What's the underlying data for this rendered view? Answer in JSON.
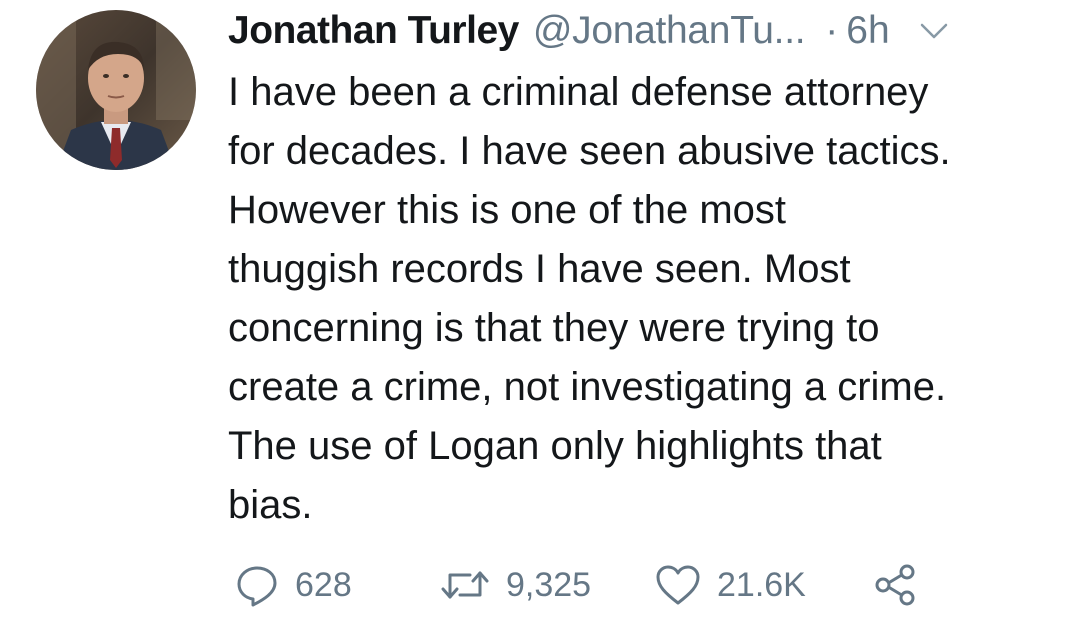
{
  "tweet": {
    "author": {
      "name": "Jonathan Turley",
      "handle": "@JonathanTu...",
      "avatar_icon": "profile-photo"
    },
    "separator": "·",
    "time": "6h",
    "menu_icon": "chevron-down-icon",
    "text_lines": [
      "I have been a criminal defense attorney",
      "for decades. I have seen abusive tactics.",
      "However this is one of the most",
      "thuggish records I have seen. Most",
      "concerning is that they were trying to",
      "create a crime, not investigating a crime.",
      "The use of Logan only highlights that",
      "bias."
    ],
    "actions": {
      "reply": {
        "icon": "reply-icon",
        "count": "628"
      },
      "retweet": {
        "icon": "retweet-icon",
        "count": "9,325"
      },
      "like": {
        "icon": "heart-icon",
        "count": "21.6K"
      },
      "share": {
        "icon": "share-icon"
      }
    }
  },
  "colors": {
    "text_primary": "#14171a",
    "text_secondary": "#657786",
    "background": "#ffffff"
  }
}
